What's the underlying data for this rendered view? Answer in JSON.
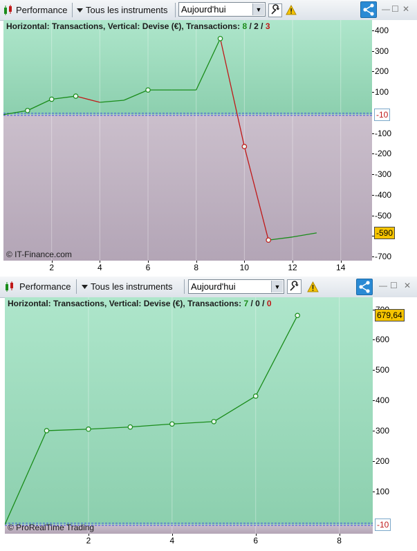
{
  "panels": [
    {
      "toolbar": {
        "performance_label": "Performance",
        "instruments_label": "Tous les instruments",
        "period_value": "Aujourd'hui"
      },
      "legend": {
        "prefix": "Horizontal: Transactions, Vertical: Devise (€), Transactions: ",
        "wins": "8",
        "sep1": " / ",
        "neutral": "2",
        "sep2": " / ",
        "losses": "3"
      },
      "copyright": "© IT-Finance.com",
      "badges": {
        "zero_label": "-10",
        "current_label": "-590"
      },
      "chart_data": {
        "type": "line",
        "x": [
          0,
          1,
          2,
          3,
          4,
          5,
          6,
          7,
          8,
          9,
          10,
          11,
          12,
          13
        ],
        "y": [
          -10,
          10,
          65,
          80,
          50,
          60,
          110,
          110,
          110,
          360,
          -165,
          -620,
          -605,
          -585
        ],
        "markers_at": [
          1,
          2,
          3,
          6,
          9,
          10,
          11
        ],
        "xlim": [
          0,
          15.3
        ],
        "ylim": [
          -720,
          450
        ],
        "x_ticks": [
          2,
          4,
          6,
          8,
          10,
          12,
          14
        ],
        "y_ticks": [
          400,
          300,
          200,
          100,
          -100,
          -200,
          -300,
          -400,
          -500,
          -600,
          -700
        ],
        "zero_line": -10,
        "colors": {
          "up": "#1a8c1a",
          "down": "#c01818",
          "above": "#a6e0c3",
          "below": "#c4b8c8"
        }
      }
    },
    {
      "toolbar": {
        "performance_label": "Performance",
        "instruments_label": "Tous les instruments",
        "period_value": "Aujourd'hui"
      },
      "legend": {
        "prefix": "Horizontal: Transactions, Vertical: Devise (€), Transactions: ",
        "wins": "7",
        "sep1": " / ",
        "neutral": "0",
        "sep2": " / ",
        "losses": "0"
      },
      "copyright": "© ProRealTime Trading",
      "badges": {
        "zero_label": "-10",
        "current_label": "679,64"
      },
      "chart_data": {
        "type": "line",
        "x": [
          0,
          1,
          2,
          3,
          4,
          5,
          6,
          7
        ],
        "y": [
          -10,
          300,
          305,
          312,
          322,
          330,
          414,
          680
        ],
        "markers_at": [
          1,
          2,
          3,
          4,
          5,
          6,
          7
        ],
        "xlim": [
          0,
          8.8
        ],
        "ylim": [
          -40,
          740
        ],
        "x_ticks": [
          2,
          4,
          6,
          8
        ],
        "y_ticks": [
          700,
          600,
          500,
          400,
          300,
          200,
          100
        ],
        "zero_line": -10,
        "colors": {
          "up": "#1a8c1a",
          "down": "#c01818",
          "above": "#a6e0c3",
          "below": "#c4b8c8"
        }
      }
    }
  ]
}
